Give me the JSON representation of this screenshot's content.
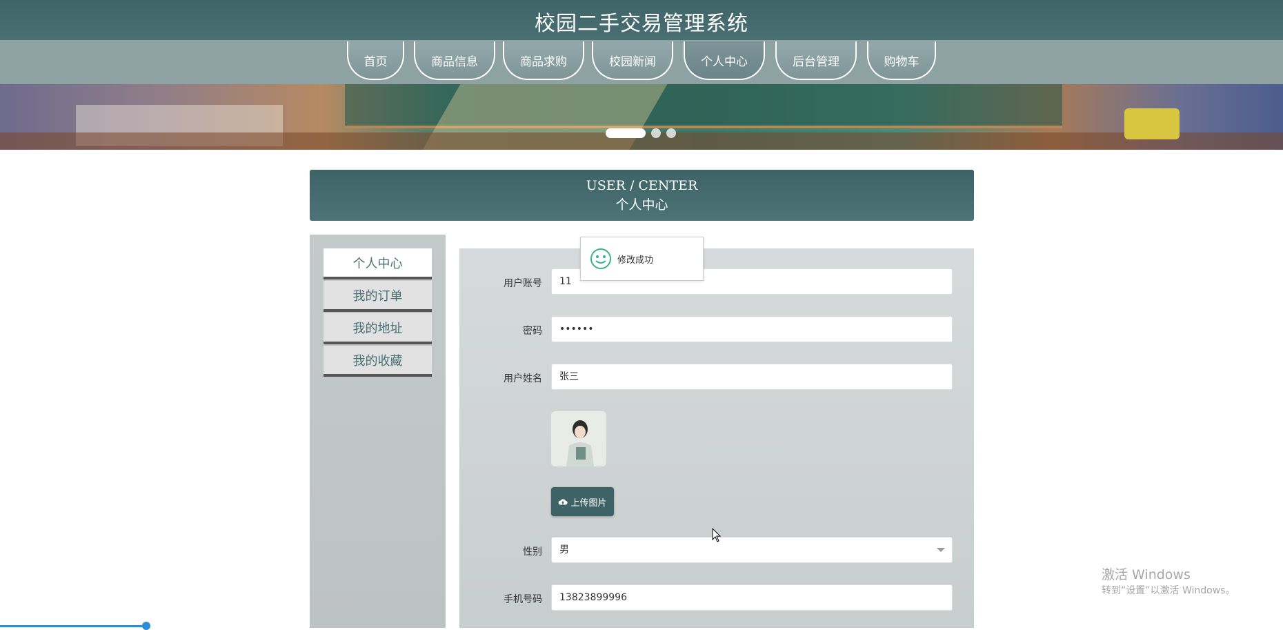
{
  "header": {
    "title": "校园二手交易管理系统"
  },
  "nav": {
    "items": [
      "首页",
      "商品信息",
      "商品求购",
      "校园新闻",
      "个人中心",
      "后台管理",
      "购物车"
    ],
    "active_index": 4
  },
  "banner": {
    "slides": 3,
    "active_slide": 1
  },
  "section": {
    "title_en": "USER / CENTER",
    "title_cn": "个人中心"
  },
  "side_menu": {
    "items": [
      "个人中心",
      "我的订单",
      "我的地址",
      "我的收藏"
    ],
    "active_index": 0
  },
  "form": {
    "account_label": "用户账号",
    "account_value": "11",
    "password_label": "密码",
    "password_value": "••••••",
    "name_label": "用户姓名",
    "name_value": "张三",
    "upload_label": "上传图片",
    "gender_label": "性别",
    "gender_value": "男",
    "phone_label": "手机号码",
    "phone_value": "13823899996"
  },
  "toast": {
    "message": "修改成功"
  },
  "watermark": {
    "line1": "激活 Windows",
    "line2": "转到“设置”以激活 Windows。"
  },
  "colors": {
    "primary": "#3e6367",
    "nav": "#8ea2a4",
    "panel": "#d0d4d4",
    "toast_icon": "#3bb18a"
  }
}
